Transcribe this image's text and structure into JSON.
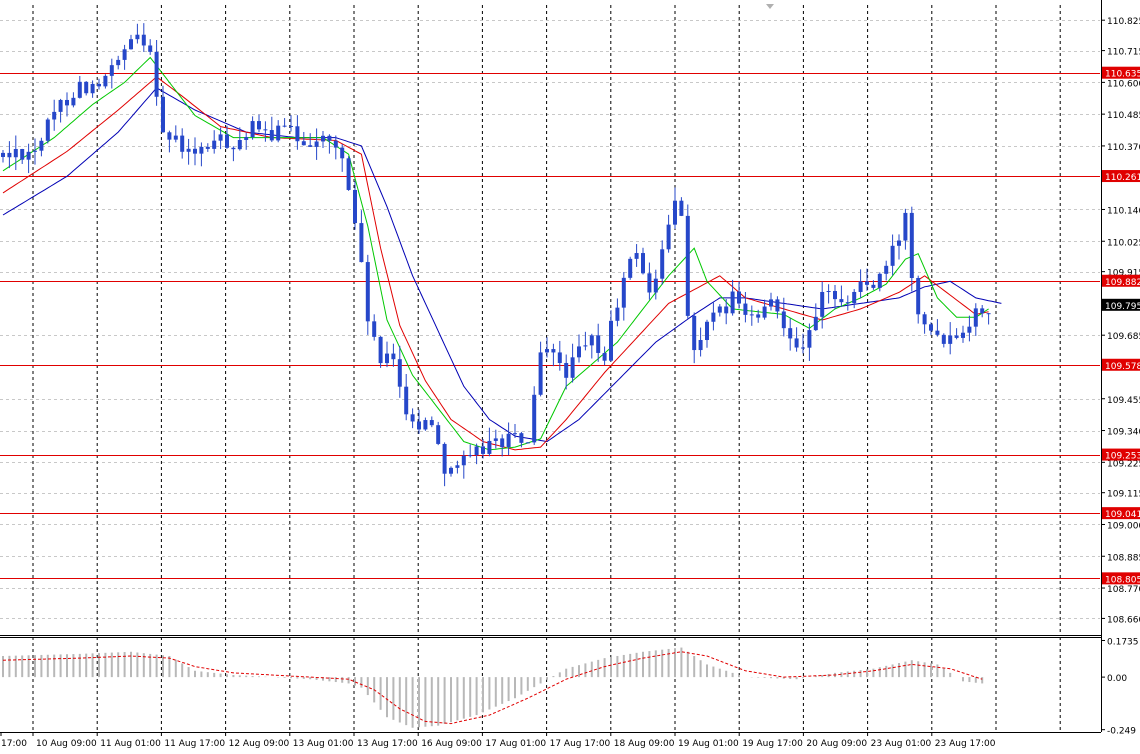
{
  "chart_data": {
    "type": "candlestick",
    "main": {
      "ylim": [
        108.6,
        110.88
      ],
      "y_ticks": [
        "110.825",
        "110.715",
        "110.600",
        "110.485",
        "110.370",
        "110.140",
        "110.025",
        "109.915",
        "109.685",
        "109.455",
        "109.340",
        "109.225",
        "109.115",
        "109.000",
        "108.885",
        "108.770",
        "108.660"
      ],
      "current_price": {
        "value": 109.795,
        "label": "109.795"
      },
      "levels": [
        {
          "value": 110.635,
          "label": "110.635"
        },
        {
          "value": 110.261,
          "label": "110.261"
        },
        {
          "value": 109.882,
          "label": "109.882"
        },
        {
          "value": 109.578,
          "label": "109.578"
        },
        {
          "value": 109.253,
          "label": "109.253"
        },
        {
          "value": 109.041,
          "label": "109.041"
        },
        {
          "value": 108.805,
          "label": "108.805"
        }
      ],
      "price_path": [
        [
          0,
          110.33
        ],
        [
          6,
          110.36
        ],
        [
          10,
          110.52
        ],
        [
          13,
          110.59
        ],
        [
          16,
          110.58
        ],
        [
          20,
          110.7
        ],
        [
          22,
          110.77
        ],
        [
          24,
          110.73
        ],
        [
          26,
          110.42
        ],
        [
          28,
          110.38
        ],
        [
          31,
          110.33
        ],
        [
          34,
          110.39
        ],
        [
          37,
          110.38
        ],
        [
          40,
          110.43
        ],
        [
          42,
          110.41
        ],
        [
          45,
          110.43
        ],
        [
          48,
          110.39
        ],
        [
          50,
          110.4
        ],
        [
          52,
          110.38
        ],
        [
          54,
          110.33
        ],
        [
          56,
          110.1
        ],
        [
          58,
          109.75
        ],
        [
          60,
          109.58
        ],
        [
          62,
          109.6
        ],
        [
          64,
          109.42
        ],
        [
          66,
          109.35
        ],
        [
          68,
          109.38
        ],
        [
          70,
          109.21
        ],
        [
          72,
          109.22
        ],
        [
          74,
          109.23
        ],
        [
          76,
          109.28
        ],
        [
          78,
          109.3
        ],
        [
          80,
          109.31
        ],
        [
          83,
          109.3
        ],
        [
          85,
          109.6
        ],
        [
          87,
          109.62
        ],
        [
          89,
          109.55
        ],
        [
          91,
          109.62
        ],
        [
          93,
          109.66
        ],
        [
          95,
          109.6
        ],
        [
          96,
          109.72
        ],
        [
          98,
          109.88
        ],
        [
          100,
          110.0
        ],
        [
          102,
          109.83
        ],
        [
          104,
          109.98
        ],
        [
          106,
          110.17
        ],
        [
          107,
          110.12
        ],
        [
          108,
          109.78
        ],
        [
          109,
          109.62
        ],
        [
          111,
          109.72
        ],
        [
          113,
          109.76
        ],
        [
          115,
          109.82
        ],
        [
          117,
          109.76
        ],
        [
          119,
          109.74
        ],
        [
          121,
          109.8
        ],
        [
          123,
          109.74
        ],
        [
          125,
          109.65
        ],
        [
          127,
          109.68
        ],
        [
          129,
          109.82
        ],
        [
          131,
          109.84
        ],
        [
          133,
          109.8
        ],
        [
          135,
          109.88
        ],
        [
          137,
          109.86
        ],
        [
          139,
          109.93
        ],
        [
          141,
          110.04
        ],
        [
          142,
          110.12
        ],
        [
          143,
          109.92
        ],
        [
          144,
          109.78
        ],
        [
          146,
          109.72
        ],
        [
          148,
          109.68
        ],
        [
          150,
          109.7
        ],
        [
          152,
          109.74
        ],
        [
          154,
          109.79
        ]
      ],
      "ma_fast_path": [
        [
          0,
          110.28
        ],
        [
          8,
          110.4
        ],
        [
          14,
          110.52
        ],
        [
          19,
          110.6
        ],
        [
          23,
          110.69
        ],
        [
          26,
          110.6
        ],
        [
          30,
          110.48
        ],
        [
          36,
          110.4
        ],
        [
          42,
          110.4
        ],
        [
          50,
          110.4
        ],
        [
          54,
          110.34
        ],
        [
          57,
          110.08
        ],
        [
          60,
          109.74
        ],
        [
          64,
          109.54
        ],
        [
          68,
          109.42
        ],
        [
          72,
          109.3
        ],
        [
          76,
          109.27
        ],
        [
          80,
          109.28
        ],
        [
          84,
          109.31
        ],
        [
          88,
          109.5
        ],
        [
          92,
          109.58
        ],
        [
          96,
          109.66
        ],
        [
          100,
          109.78
        ],
        [
          104,
          109.9
        ],
        [
          108,
          110.0
        ],
        [
          110,
          109.88
        ],
        [
          114,
          109.78
        ],
        [
          118,
          109.77
        ],
        [
          122,
          109.76
        ],
        [
          126,
          109.71
        ],
        [
          130,
          109.78
        ],
        [
          134,
          109.82
        ],
        [
          138,
          109.87
        ],
        [
          141,
          109.96
        ],
        [
          143,
          109.98
        ],
        [
          146,
          109.82
        ],
        [
          149,
          109.75
        ],
        [
          152,
          109.75
        ],
        [
          154,
          109.78
        ]
      ],
      "ma_mid_path": [
        [
          0,
          110.2
        ],
        [
          10,
          110.35
        ],
        [
          18,
          110.5
        ],
        [
          24,
          110.62
        ],
        [
          28,
          110.55
        ],
        [
          34,
          110.44
        ],
        [
          42,
          110.4
        ],
        [
          52,
          110.39
        ],
        [
          56,
          110.34
        ],
        [
          59,
          110.0
        ],
        [
          62,
          109.72
        ],
        [
          66,
          109.52
        ],
        [
          70,
          109.38
        ],
        [
          75,
          109.3
        ],
        [
          80,
          109.27
        ],
        [
          84,
          109.28
        ],
        [
          88,
          109.38
        ],
        [
          94,
          109.55
        ],
        [
          100,
          109.7
        ],
        [
          104,
          109.8
        ],
        [
          108,
          109.85
        ],
        [
          112,
          109.9
        ],
        [
          116,
          109.82
        ],
        [
          122,
          109.78
        ],
        [
          128,
          109.74
        ],
        [
          134,
          109.78
        ],
        [
          140,
          109.84
        ],
        [
          144,
          109.9
        ],
        [
          148,
          109.83
        ],
        [
          152,
          109.76
        ],
        [
          154,
          109.77
        ]
      ],
      "ma_slow_path": [
        [
          0,
          110.12
        ],
        [
          10,
          110.26
        ],
        [
          18,
          110.42
        ],
        [
          24,
          110.58
        ],
        [
          30,
          110.5
        ],
        [
          38,
          110.42
        ],
        [
          46,
          110.4
        ],
        [
          52,
          110.4
        ],
        [
          56,
          110.37
        ],
        [
          60,
          110.15
        ],
        [
          64,
          109.9
        ],
        [
          68,
          109.7
        ],
        [
          72,
          109.5
        ],
        [
          76,
          109.38
        ],
        [
          80,
          109.32
        ],
        [
          85,
          109.3
        ],
        [
          90,
          109.38
        ],
        [
          96,
          109.52
        ],
        [
          102,
          109.66
        ],
        [
          108,
          109.76
        ],
        [
          112,
          109.82
        ],
        [
          116,
          109.82
        ],
        [
          122,
          109.8
        ],
        [
          128,
          109.78
        ],
        [
          134,
          109.8
        ],
        [
          140,
          109.82
        ],
        [
          144,
          109.86
        ],
        [
          148,
          109.88
        ],
        [
          152,
          109.82
        ],
        [
          156,
          109.8
        ]
      ]
    },
    "oscillator": {
      "ylim": [
        -0.26,
        0.19
      ],
      "y_ticks": [
        "0.1735",
        "0.00",
        "-0.249"
      ],
      "histogram_path": [
        [
          0,
          0.1
        ],
        [
          12,
          0.11
        ],
        [
          20,
          0.12
        ],
        [
          26,
          0.1
        ],
        [
          30,
          0.03
        ],
        [
          36,
          0.01
        ],
        [
          42,
          0.0
        ],
        [
          48,
          -0.01
        ],
        [
          54,
          -0.03
        ],
        [
          56,
          -0.05
        ],
        [
          60,
          -0.19
        ],
        [
          64,
          -0.24
        ],
        [
          68,
          -0.23
        ],
        [
          74,
          -0.18
        ],
        [
          80,
          -0.1
        ],
        [
          84,
          -0.03
        ],
        [
          88,
          0.04
        ],
        [
          94,
          0.09
        ],
        [
          100,
          0.12
        ],
        [
          106,
          0.14
        ],
        [
          110,
          0.06
        ],
        [
          116,
          0.0
        ],
        [
          124,
          -0.01
        ],
        [
          130,
          0.02
        ],
        [
          136,
          0.04
        ],
        [
          142,
          0.08
        ],
        [
          146,
          0.06
        ],
        [
          150,
          -0.02
        ],
        [
          153,
          -0.03
        ]
      ],
      "signal_path": [
        [
          0,
          0.08
        ],
        [
          12,
          0.09
        ],
        [
          20,
          0.1
        ],
        [
          26,
          0.09
        ],
        [
          30,
          0.05
        ],
        [
          36,
          0.02
        ],
        [
          42,
          0.01
        ],
        [
          48,
          0.0
        ],
        [
          54,
          -0.01
        ],
        [
          58,
          -0.06
        ],
        [
          62,
          -0.15
        ],
        [
          66,
          -0.21
        ],
        [
          70,
          -0.22
        ],
        [
          76,
          -0.18
        ],
        [
          82,
          -0.1
        ],
        [
          88,
          -0.01
        ],
        [
          94,
          0.05
        ],
        [
          100,
          0.09
        ],
        [
          106,
          0.12
        ],
        [
          110,
          0.1
        ],
        [
          116,
          0.03
        ],
        [
          122,
          0.0
        ],
        [
          130,
          0.01
        ],
        [
          136,
          0.03
        ],
        [
          142,
          0.06
        ],
        [
          148,
          0.04
        ],
        [
          153,
          -0.01
        ]
      ]
    },
    "x_labels": [
      "17:00",
      "10 Aug 09:00",
      "11 Aug 01:00",
      "11 Aug 17:00",
      "12 Aug 09:00",
      "13 Aug 01:00",
      "13 Aug 17:00",
      "16 Aug 09:00",
      "17 Aug 01:00",
      "17 Aug 17:00",
      "18 Aug 09:00",
      "19 Aug 01:00",
      "19 Aug 17:00",
      "20 Aug 09:00",
      "23 Aug 01:00",
      "23 Aug 17:00"
    ],
    "grid": true,
    "colors": {
      "candle": "#2647c9",
      "level": "#e00000",
      "level_label_bg": "#e00000",
      "ma_fast": "#00c800",
      "ma_mid": "#e00000",
      "ma_slow": "#0000b4",
      "grid": "#c8c8c8",
      "vgrid": "#000000",
      "osc_bar": "#b8b8b8",
      "osc_signal": "#e00000",
      "current_bg": "#000000"
    }
  }
}
